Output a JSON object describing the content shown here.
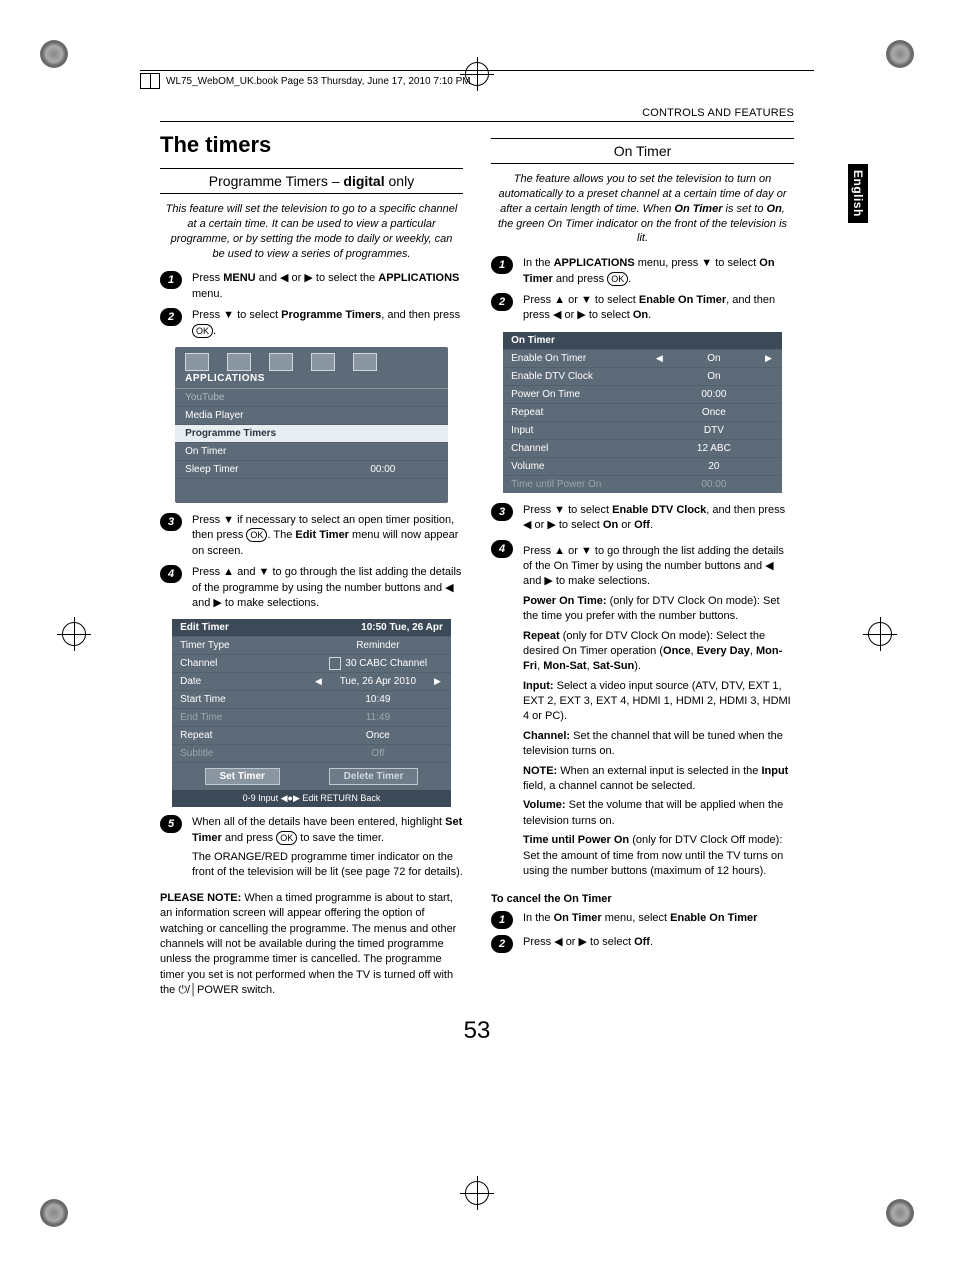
{
  "meta": {
    "book_line": "WL75_WebOM_UK.book  Page 53  Thursday, June 17, 2010  7:10 PM",
    "header_right": "CONTROLS AND FEATURES",
    "side_tab": "English",
    "page_number": "53"
  },
  "left": {
    "title": "The timers",
    "section_head_prefix": "Programme Timers – ",
    "section_head_bold": "digital",
    "section_head_suffix": " only",
    "intro": "This feature will set the television to go to a specific channel at a certain time. It can be used to view a particular programme, or by setting the mode to daily or weekly, can be used to view a series of programmes.",
    "step1_a": "Press ",
    "step1_b": "MENU",
    "step1_c": " and ◀ or ▶ to select the ",
    "step1_d": "APPLICATIONS",
    "step1_e": " menu.",
    "step2_a": "Press ▼ to select ",
    "step2_b": "Programme Timers",
    "step2_c": ", and then press ",
    "step2_ok": "OK",
    "step2_d": ".",
    "osd1": {
      "title": "APPLICATIONS",
      "rows": [
        {
          "label": "YouTube",
          "value": "",
          "sel": false,
          "dim": true
        },
        {
          "label": "Media Player",
          "value": "",
          "sel": false
        },
        {
          "label": "Programme Timers",
          "value": "",
          "sel": true,
          "hl": true
        },
        {
          "label": "On Timer",
          "value": "",
          "sel": false
        },
        {
          "label": "Sleep Timer",
          "value": "00:00",
          "sel": false
        }
      ]
    },
    "step3_a": "Press ▼ if necessary to select an open timer position, then press ",
    "step3_ok": "OK",
    "step3_b": ". The ",
    "step3_c": "Edit Timer",
    "step3_d": " menu will now appear on screen.",
    "step4": "Press ▲ and ▼ to go through the list adding the details of the programme by using the number buttons and ◀ and ▶ to make selections.",
    "osd2": {
      "title_left": "Edit Timer",
      "title_right": "10:50 Tue, 26 Apr",
      "rows": [
        {
          "label": "Timer Type",
          "value": "Reminder"
        },
        {
          "label": "Channel",
          "value": "30 CABC Channel",
          "icon": true
        },
        {
          "label": "Date",
          "value": "Tue, 26 Apr 2010",
          "arrows": true
        },
        {
          "label": "Start Time",
          "value": "10:49"
        },
        {
          "label": "End Time",
          "value": "11:49",
          "dim": true
        },
        {
          "label": "Repeat",
          "value": "Once"
        },
        {
          "label": "Subtitle",
          "value": "Off",
          "dim": true
        }
      ],
      "btn_set": "Set Timer",
      "btn_del": "Delete Timer",
      "foot": "0-9  Input   ◀●▶ Edit   RETURN  Back"
    },
    "step5_a": "When all of the details have been entered, highlight ",
    "step5_b": "Set Timer",
    "step5_c": " and press ",
    "step5_ok": "OK",
    "step5_d": " to save the timer.",
    "step5_p2": "The ORANGE/RED programme timer indicator on the front of the television will be lit (see page 72 for details).",
    "please_note_label": "PLEASE NOTE:",
    "please_note": " When a timed programme is about to start, an information screen will appear offering the option of watching or cancelling the programme. The menus and other channels will not be available during the timed programme unless the programme timer is cancelled. The programme timer you set is not performed when the TV is turned off with the ⏻/│POWER switch."
  },
  "right": {
    "section_head": "On Timer",
    "intro": "The feature allows you to set the television to turn on automatically to a preset channel at a certain time of day or after a certain length of time. When On Timer is set to On, the green On Timer indicator on the front of the television is lit.",
    "step1_a": "In the ",
    "step1_b": "APPLICATIONS",
    "step1_c": " menu, press ▼ to select ",
    "step1_d": "On Timer",
    "step1_e": " and press ",
    "step1_ok": "OK",
    "step1_f": ".",
    "step2_a": "Press ▲ or ▼ to select ",
    "step2_b": "Enable On Timer",
    "step2_c": ", and then press ◀ or ▶ to select ",
    "step2_d": "On",
    "step2_e": ".",
    "osd3": {
      "title": "On Timer",
      "rows": [
        {
          "label": "Enable On Timer",
          "value": "On",
          "arrows": true
        },
        {
          "label": "Enable DTV Clock",
          "value": "On"
        },
        {
          "label": "Power On Time",
          "value": "00:00"
        },
        {
          "label": "Repeat",
          "value": "Once"
        },
        {
          "label": "Input",
          "value": "DTV"
        },
        {
          "label": "Channel",
          "value": "12 ABC"
        },
        {
          "label": "Volume",
          "value": "20"
        },
        {
          "label": "Time until Power On",
          "value": "00:00",
          "dim": true
        }
      ]
    },
    "step3_a": "Press ▼ to select ",
    "step3_b": "Enable DTV Clock",
    "step3_c": ", and then press ◀ or ▶ to select ",
    "step3_d": "On",
    "step3_e": " or ",
    "step3_f": "Off",
    "step3_g": ".",
    "step4": "Press ▲ or ▼ to go through the list adding the details of the On Timer by using the number buttons and ◀ and ▶ to make selections.",
    "pot_b": "Power On Time",
    "pot_t": " (only for DTV Clock On mode): Set the time you prefer with the number buttons.",
    "rep_b": "Repeat",
    "rep_t": " (only for DTV Clock On mode): Select the desired On Timer operation (",
    "rep_o1": "Once",
    "rep_c1": ", ",
    "rep_o2": "Every Day",
    "rep_c2": ", ",
    "rep_o3": "Mon-Fri",
    "rep_c3": ", ",
    "rep_o4": "Mon-Sat",
    "rep_c4": ", ",
    "rep_o5": "Sat-Sun",
    "rep_end": ").",
    "inp_b": "Input:",
    "inp_t": " Select a video input source (ATV, DTV, EXT 1, EXT 2, EXT 3, EXT 4, HDMI 1, HDMI 2, HDMI 3, HDMI 4 or PC).",
    "ch_b": "Channel:",
    "ch_t": " Set the channel that will be tuned when the television turns on.",
    "note_b": "NOTE:",
    "note_t": " When an external input is selected in the Input field, a channel cannot be selected.",
    "vol_b": "Volume:",
    "vol_t": " Set the volume that will be applied when the television turns on.",
    "tup_b": "Time until Power On",
    "tup_t": " (only for DTV Clock Off mode): Set the amount of time from now until the TV turns on using the number buttons (maximum of 12 hours).",
    "cancel_head": "To cancel the On Timer",
    "c1_a": "In the ",
    "c1_b": "On Timer",
    "c1_c": " menu, select ",
    "c1_d": "Enable On Timer",
    "c2": "Press ◀ or ▶ to select Off."
  }
}
